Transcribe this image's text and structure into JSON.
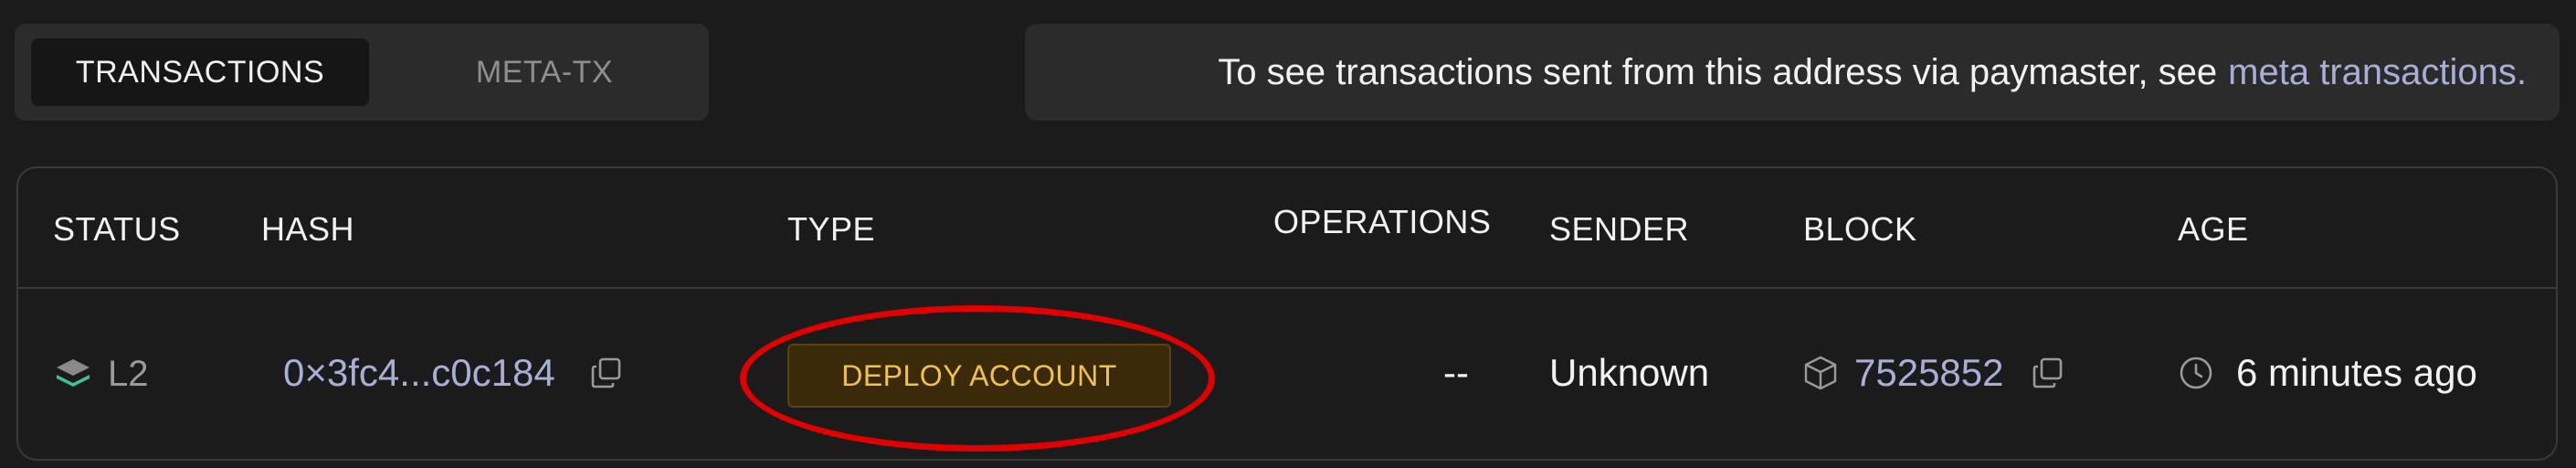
{
  "tabs": [
    {
      "label": "TRANSACTIONS",
      "active": true
    },
    {
      "label": "META-TX",
      "active": false
    }
  ],
  "notice": {
    "text": "To see transactions sent from this address via paymaster, see",
    "link": "meta transactions."
  },
  "table": {
    "headers": {
      "status": "STATUS",
      "hash": "HASH",
      "type": "TYPE",
      "operations": "OPERATIONS",
      "sender": "SENDER",
      "block": "BLOCK",
      "age": "AGE"
    },
    "rows": [
      {
        "status": "L2",
        "hash": "0×3fc4...c0c184",
        "type": "DEPLOY ACCOUNT",
        "operations": "--",
        "sender": "Unknown",
        "block": "7525852",
        "age": "6 minutes ago"
      }
    ]
  },
  "icons": {
    "status": "layers-icon",
    "copy": "copy-icon",
    "block": "cube-icon",
    "age": "clock-icon"
  },
  "colors": {
    "background": "#1b1b1b",
    "panel": "#2b2b2b",
    "link": "#a8afd6",
    "badge_text": "#f2c14b",
    "badge_bg": "#3a2a0a",
    "status_accent": "#3ec28f",
    "highlight": "#e00000"
  }
}
